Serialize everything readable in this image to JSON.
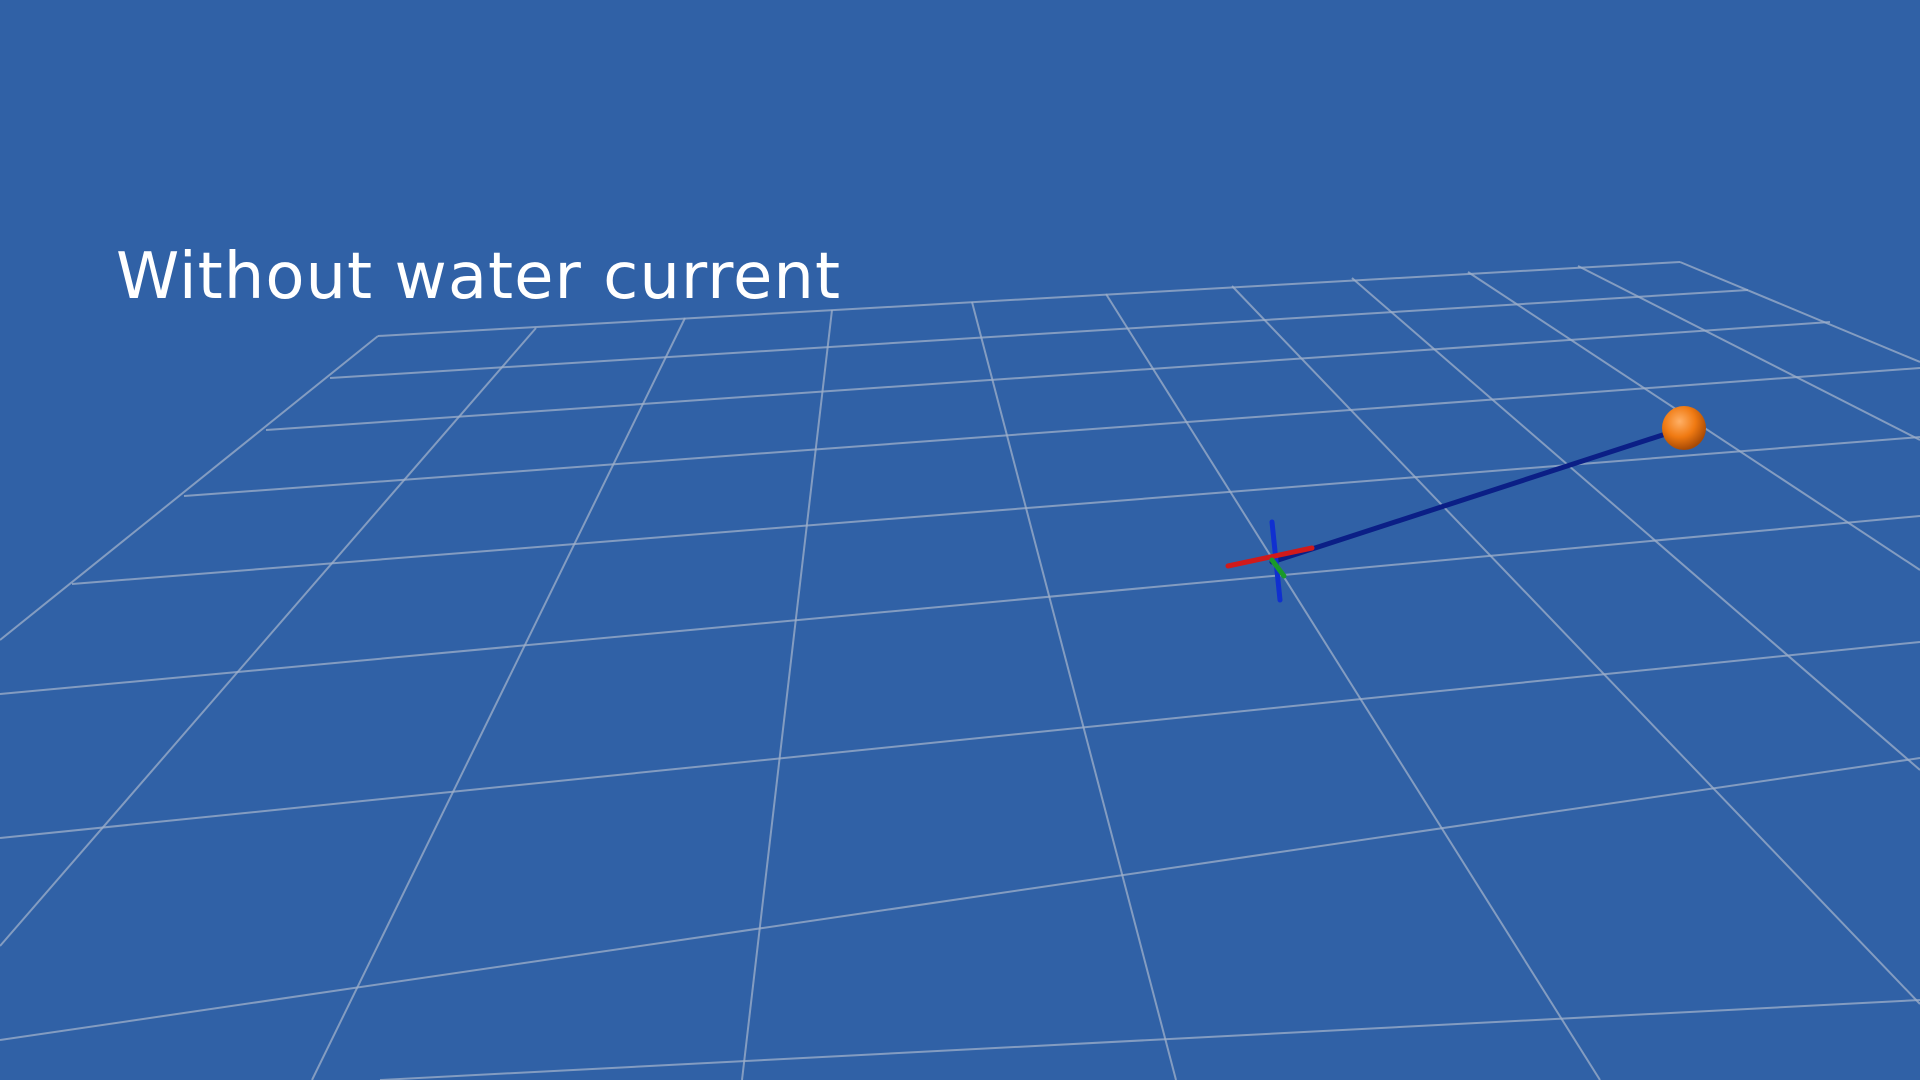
{
  "overlay": {
    "caption": "Without water current"
  },
  "scene": {
    "background_color": "#3061a6",
    "grid_color": "#9fb0c9",
    "trajectory_color": "#0b1f86",
    "goal_marker_color": "#f07a12",
    "axis_colors": {
      "x": "#d11a1a",
      "y": "#1a9a2a",
      "z": "#1030d0"
    },
    "icons": {
      "goal": "orange-sphere-icon",
      "robot_frame": "axes-triad-icon"
    }
  }
}
